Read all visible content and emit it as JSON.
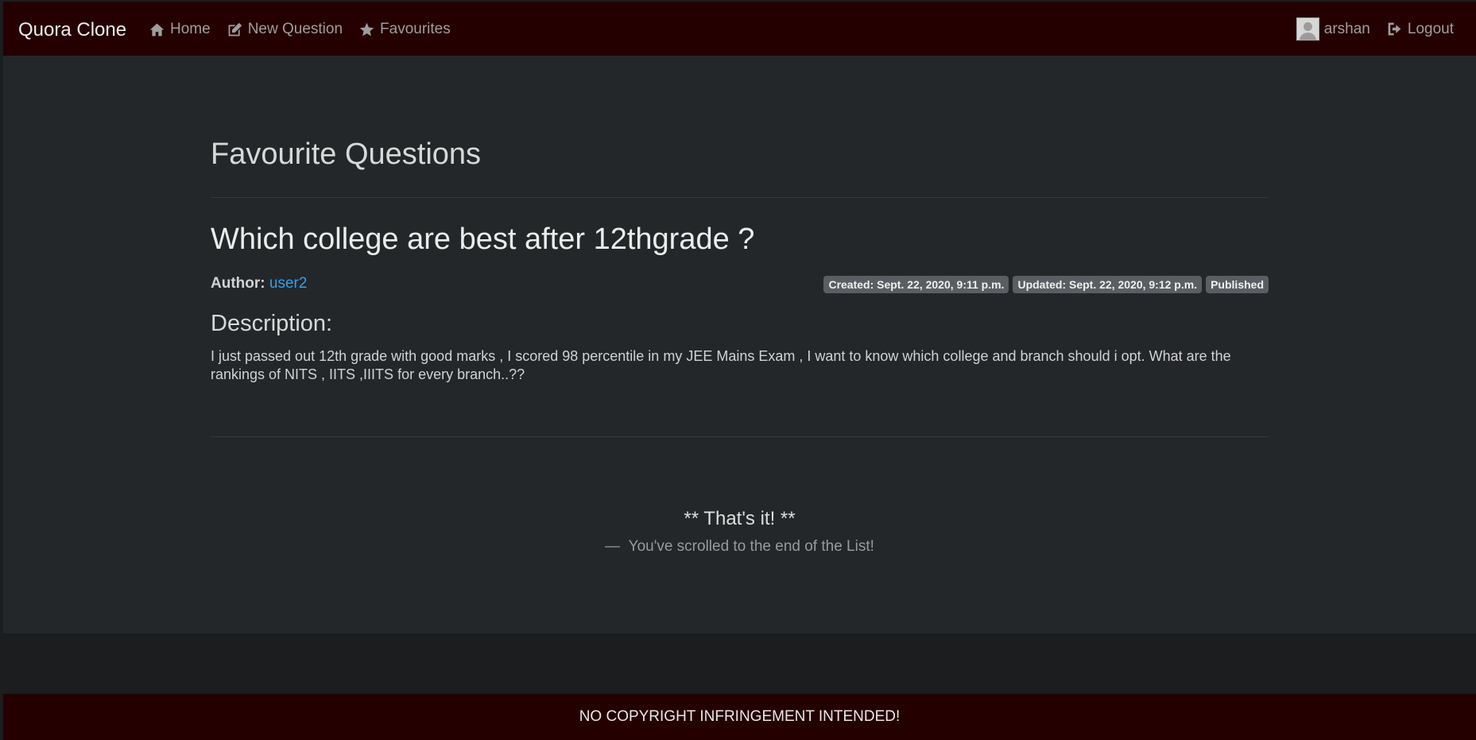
{
  "navbar": {
    "brand": "Quora Clone",
    "links": [
      {
        "label": "Home",
        "icon": "home-icon"
      },
      {
        "label": "New Question",
        "icon": "edit-icon"
      },
      {
        "label": "Favourites",
        "icon": "star-icon"
      }
    ],
    "user": {
      "name": "arshan",
      "icon": "avatar"
    },
    "logout": {
      "label": "Logout",
      "icon": "logout-icon"
    }
  },
  "page": {
    "title": "Favourite Questions"
  },
  "question": {
    "title": "Which college are best after 12thgrade ?",
    "author_label": "Author:",
    "author": "user2",
    "created": "Created: Sept. 22, 2020, 9:11 p.m.",
    "updated": "Updated: Sept. 22, 2020, 9:12 p.m.",
    "status": "Published",
    "description_heading": "Description:",
    "description": "I just passed out 12th grade with good marks , I scored 98 percentile in my JEE Mains Exam , I want to know which college and branch should i opt. What are the rankings of NITS , IITS ,IIITS for every branch..??"
  },
  "end_of_list": {
    "title": "** That's it! **",
    "subtitle": "—  You've scrolled to the end of the List!"
  },
  "footer": {
    "text": "NO COPYRIGHT INFRINGEMENT INTENDED!"
  },
  "colors": {
    "navbar_bg": "#240000",
    "content_bg": "#232729",
    "link": "#3c9ee8",
    "badge_bg": "#5a5e62"
  }
}
